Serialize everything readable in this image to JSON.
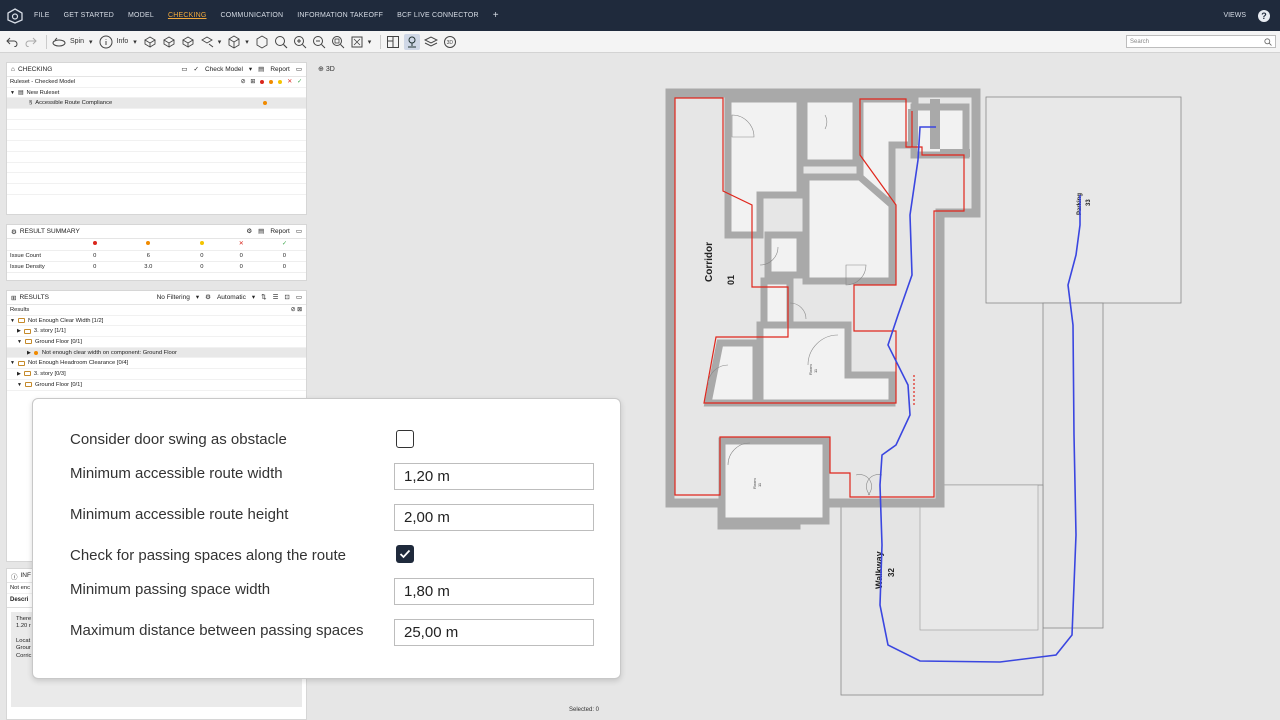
{
  "menu": {
    "items": [
      "FILE",
      "GET STARTED",
      "MODEL",
      "CHECKING",
      "COMMUNICATION",
      "INFORMATION TAKEOFF",
      "BCF LIVE CONNECTOR"
    ],
    "active": "CHECKING",
    "plus": "+",
    "views": "VIEWS",
    "help": "?"
  },
  "toolbar": {
    "spin_label": "Spin",
    "info_label": "Info",
    "search_placeholder": "Search"
  },
  "checking": {
    "title": "CHECKING",
    "check_model": "Check Model",
    "report": "Report",
    "ruleset": "Ruleset - Checked Model",
    "new_ruleset": "New Ruleset",
    "rule": "Accessible Route Compliance"
  },
  "summary": {
    "title": "RESULT SUMMARY",
    "report": "Report",
    "rows": [
      {
        "label": "Issue Count",
        "values": [
          "0",
          "6",
          "0",
          "0",
          "0"
        ]
      },
      {
        "label": "Issue Density",
        "values": [
          "0",
          "3.0",
          "0",
          "0",
          "0"
        ]
      }
    ]
  },
  "results": {
    "title": "RESULTS",
    "filtering": "No Filtering",
    "automatic": "Automatic",
    "root": "Results",
    "items": [
      {
        "text": "Not Enough Clear Width [1/2]",
        "level": 0,
        "tri": "▼",
        "kind": "folder"
      },
      {
        "text": "3. story [1/1]",
        "level": 1,
        "tri": "▶",
        "kind": "folder"
      },
      {
        "text": "Ground Floor [0/1]",
        "level": 1,
        "tri": "▼",
        "kind": "folder"
      },
      {
        "text": "Not enough clear width on component: Ground Floor",
        "level": 2,
        "tri": "▶",
        "kind": "issue"
      },
      {
        "text": "Not Enough Headroom Clearance [0/4]",
        "level": 0,
        "tri": "▼",
        "kind": "folder"
      },
      {
        "text": "3. story [0/3]",
        "level": 1,
        "tri": "▶",
        "kind": "folder"
      },
      {
        "text": "Ground Floor [0/1]",
        "level": 1,
        "tri": "▼",
        "kind": "folder"
      }
    ]
  },
  "info_panel": {
    "title_partial": "INF",
    "line1": "Not enc",
    "tab": "Descri",
    "desc1": "There",
    "desc2": "1.20 r",
    "loc1": "Locat",
    "loc2": "Grour",
    "loc3": "Corric"
  },
  "viewport": {
    "label_3d": "3D",
    "selected": "Selected: 0"
  },
  "plan": {
    "corridor": "Corridor",
    "corridor_num": "01",
    "walkway": "Walkway",
    "walkway_num": "32",
    "parking": "Parking",
    "parking_num": "33",
    "room_label": "Room",
    "room_num": "11"
  },
  "dialog": {
    "door_swing_label": "Consider door swing as obstacle",
    "door_swing_checked": false,
    "min_width_label": "Minimum accessible route width",
    "min_width_value": "1,20 m",
    "min_height_label": "Minimum accessible route height",
    "min_height_value": "2,00 m",
    "passing_label": "Check for passing spaces along the route",
    "passing_checked": true,
    "passing_width_label": "Minimum passing space width",
    "passing_width_value": "1,80 m",
    "max_dist_label": "Maximum distance between passing spaces",
    "max_dist_value": "25,00 m"
  },
  "colors": {
    "menubar": "#1f2a3c",
    "active_menu": "#f0a83c",
    "route": "#3a46e0",
    "violation": "#e0261c",
    "wall": "#a9a9a9"
  }
}
